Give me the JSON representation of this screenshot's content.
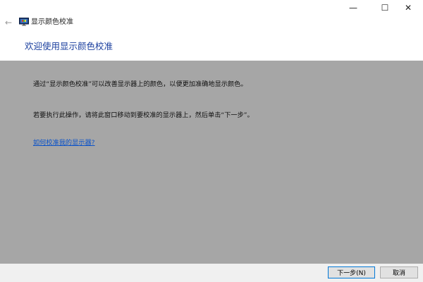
{
  "window": {
    "title": "显示颜色校准",
    "controls": {
      "minimize_icon": "—",
      "maximize_icon": "☐",
      "close_icon": "✕"
    },
    "back_icon": "←"
  },
  "page": {
    "title": "欢迎使用显示颜色校准",
    "paragraphs": [
      "通过“显示颜色校准”可以改善显示器上的颜色，以便更加准确地显示颜色。",
      "若要执行此操作，请将此窗口移动到要校准的显示器上，然后单击“下一步”。"
    ],
    "help_link": "如何校准我的显示器?"
  },
  "footer": {
    "next_label": "下一步(N)",
    "cancel_label": "取消"
  },
  "colors": {
    "content_bg": "#a6a6a6",
    "title_blue": "#1a3e9e",
    "link_blue": "#0a52c9",
    "footer_bg": "#f0f0f0"
  }
}
